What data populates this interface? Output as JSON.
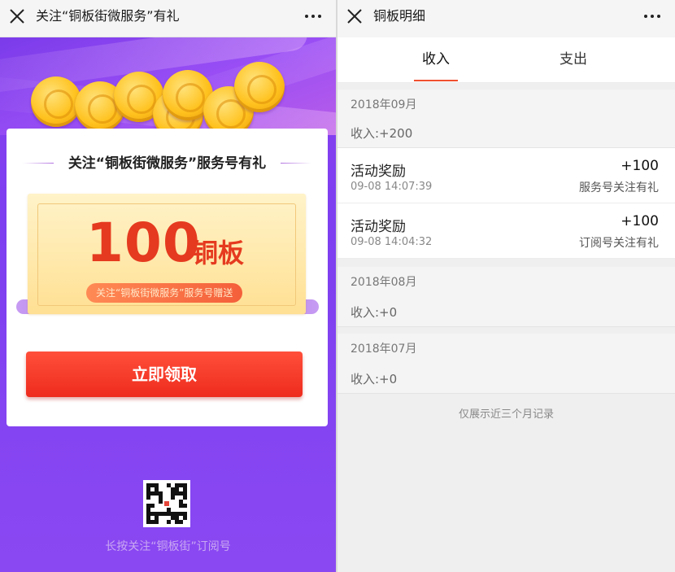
{
  "left": {
    "navbar": {
      "title": "关注“铜板街微服务”有礼"
    },
    "card": {
      "title": "关注“铜板街微服务”服务号有礼",
      "coupon": {
        "amount": "100",
        "unit": "铜板",
        "note": "关注“铜板街微服务”服务号赠送"
      },
      "claim_button": "立即领取"
    },
    "qr_caption": "长按关注“铜板街”订阅号"
  },
  "right": {
    "navbar": {
      "title": "铜板明细"
    },
    "tabs": [
      {
        "label": "收入",
        "active": true
      },
      {
        "label": "支出",
        "active": false
      }
    ],
    "groups": [
      {
        "month": "2018年09月",
        "summary": "收入:+200",
        "items": [
          {
            "title": "活动奖励",
            "time": "09-08 14:07:39",
            "amount": "+100",
            "desc": "服务号关注有礼"
          },
          {
            "title": "活动奖励",
            "time": "09-08 14:04:32",
            "amount": "+100",
            "desc": "订阅号关注有礼"
          }
        ]
      },
      {
        "month": "2018年08月",
        "summary": "收入:+0",
        "items": []
      },
      {
        "month": "2018年07月",
        "summary": "收入:+0",
        "items": []
      }
    ],
    "footnote": "仅展示近三个月记录"
  },
  "colors": {
    "accent_red": "#ee2c1e",
    "purple_bg": "#8a3ff0",
    "tab_underline": "#f0502f",
    "coupon_text": "#e53a1f"
  },
  "icons": [
    "close-icon",
    "more-icon",
    "qr-code-icon"
  ]
}
